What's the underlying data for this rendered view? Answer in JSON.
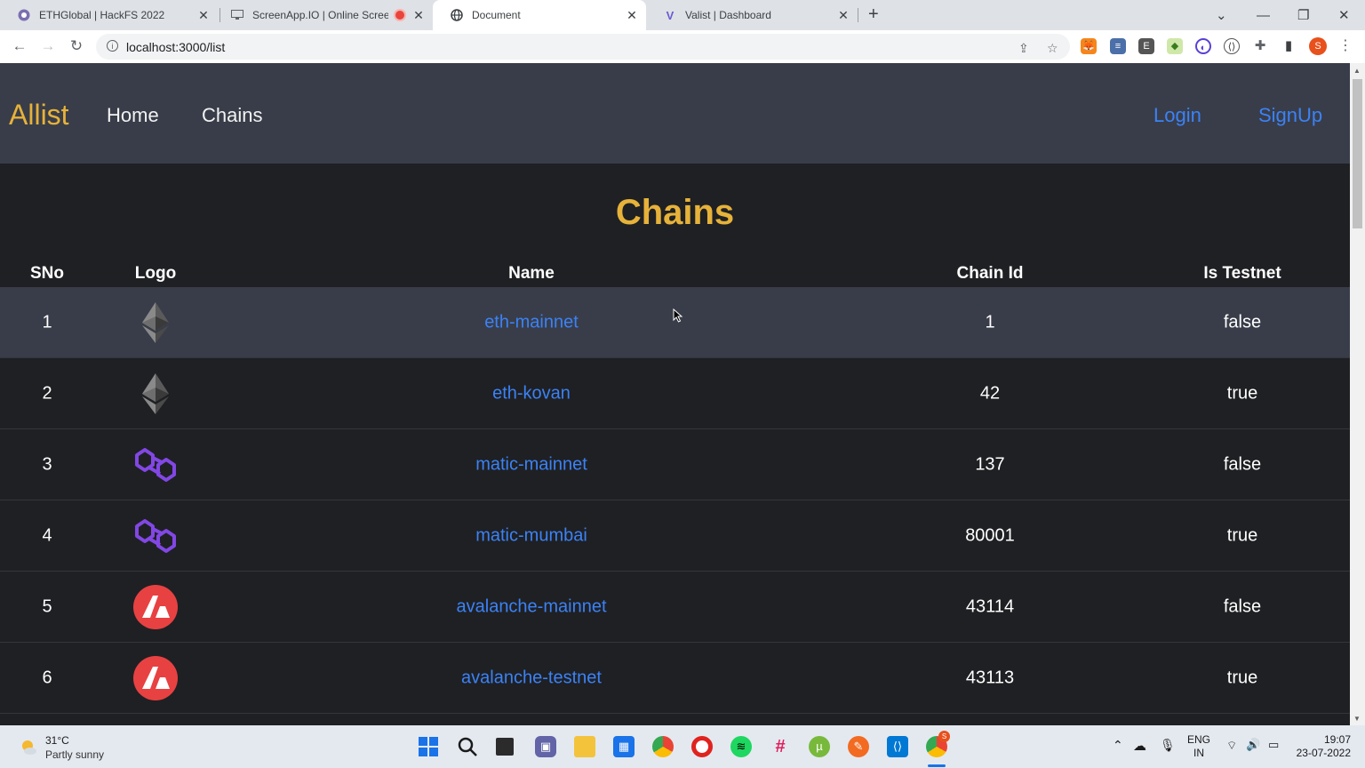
{
  "browser": {
    "tabs": [
      {
        "title": "ETHGlobal | HackFS 2022",
        "icon": "ethglobal-icon"
      },
      {
        "title": "ScreenApp.IO | Online Screen",
        "icon": "monitor-icon",
        "recording": true
      },
      {
        "title": "Document",
        "icon": "globe-icon",
        "active": true
      },
      {
        "title": "Valist | Dashboard",
        "icon": "valist-icon"
      }
    ],
    "url": "localhost:3000/list",
    "profile_initial": "S"
  },
  "navbar": {
    "brand": "Allist",
    "links": [
      "Home",
      "Chains"
    ],
    "login": "Login",
    "signup": "SignUp"
  },
  "page": {
    "heading": "Chains",
    "columns": [
      "SNo",
      "Logo",
      "Name",
      "Chain Id",
      "Is Testnet"
    ],
    "rows": [
      {
        "sno": "1",
        "logo": "ethereum-logo",
        "name": "eth-mainnet",
        "chain_id": "1",
        "is_testnet": "false"
      },
      {
        "sno": "2",
        "logo": "ethereum-logo",
        "name": "eth-kovan",
        "chain_id": "42",
        "is_testnet": "true"
      },
      {
        "sno": "3",
        "logo": "polygon-logo",
        "name": "matic-mainnet",
        "chain_id": "137",
        "is_testnet": "false"
      },
      {
        "sno": "4",
        "logo": "polygon-logo",
        "name": "matic-mumbai",
        "chain_id": "80001",
        "is_testnet": "true"
      },
      {
        "sno": "5",
        "logo": "avalanche-logo",
        "name": "avalanche-mainnet",
        "chain_id": "43114",
        "is_testnet": "false"
      },
      {
        "sno": "6",
        "logo": "avalanche-logo",
        "name": "avalanche-testnet",
        "chain_id": "43113",
        "is_testnet": "true"
      }
    ]
  },
  "taskbar": {
    "weather_temp": "31°C",
    "weather_desc": "Partly sunny",
    "lang": "ENG",
    "region": "IN",
    "time": "19:07",
    "date": "23-07-2022",
    "chrome_badge": "S"
  },
  "colors": {
    "brand": "#e6b23a",
    "link": "#3b82f6",
    "navbar_bg": "#393d49",
    "page_bg": "#1f2023",
    "polygon": "#8247e5",
    "avalanche": "#e84142"
  }
}
